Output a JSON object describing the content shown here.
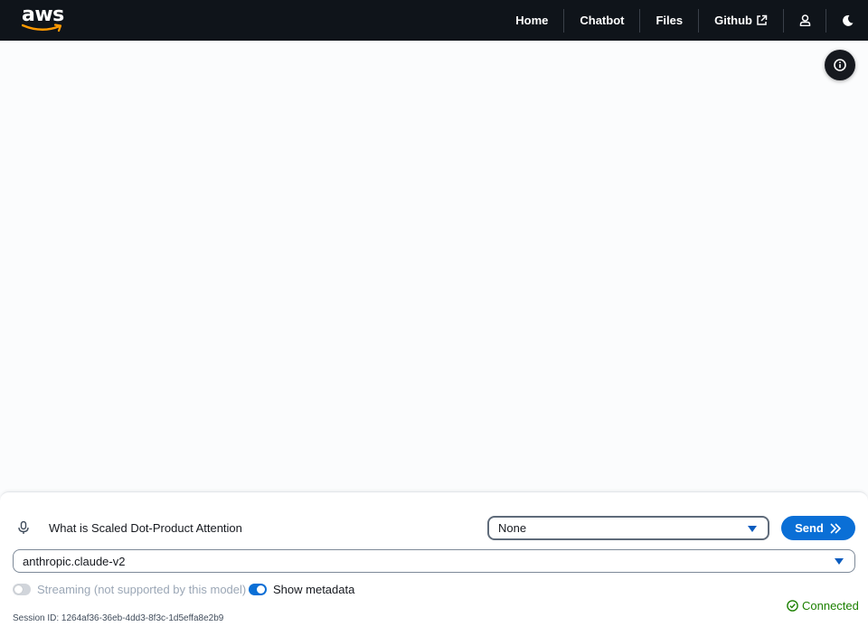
{
  "header": {
    "logo_text": "aws",
    "nav": [
      {
        "label": "Home"
      },
      {
        "label": "Chatbot"
      },
      {
        "label": "Files"
      },
      {
        "label": "Github"
      }
    ],
    "icons": [
      "external-link-icon",
      "user-icon",
      "moon-icon"
    ]
  },
  "info_button": {
    "icon": "info-icon"
  },
  "chat": {
    "prompt_value": "What is Scaled Dot-Product Attention",
    "workspace_select": "None",
    "send_label": "Send",
    "model_select": "anthropic.claude-v2",
    "streaming_label": "Streaming (not supported by this model)",
    "streaming_on": false,
    "metadata_label": "Show metadata",
    "metadata_on": true,
    "status_label": "Connected",
    "session_label": "Session ID: 1264af36-36eb-4dd3-8f3c-1d5effa8e2b9"
  },
  "colors": {
    "nav_bg": "#0f141a",
    "accent": "#0a6fd6",
    "success": "#1d8102"
  }
}
